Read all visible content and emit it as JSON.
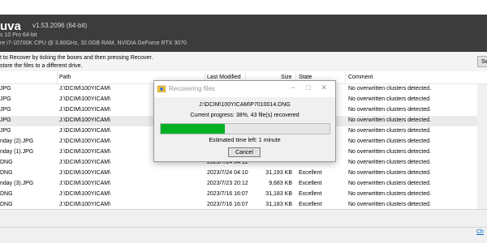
{
  "header": {
    "app_name": "uva",
    "version": "v1.53.2096 (64-bit)",
    "os": "s 10 Pro 64-bit",
    "hardware": "re i7-10700K CPU @ 3.80GHz, 32.0GB RAM, NVIDIA GeForce RTX 3070"
  },
  "instructions": {
    "line1": "t to Recover by ticking the boxes and then pressing Recover.",
    "line2": "store the files to a different drive.",
    "switch_button": "Sw"
  },
  "columns": {
    "path": "Path",
    "last_modified": "Last Modified",
    "size": "Size",
    "state": "State",
    "comment": "Comment"
  },
  "rows": [
    {
      "name": "JPG",
      "path": "J:\\DCIM\\100YICAM\\",
      "modified": "",
      "size": "",
      "state": "",
      "comment": "No overwritten clusters detected."
    },
    {
      "name": "JPG",
      "path": "J:\\DCIM\\100YICAM\\",
      "modified": "",
      "size": "",
      "state": "",
      "comment": "No overwritten clusters detected."
    },
    {
      "name": "JPG",
      "path": "J:\\DCIM\\100YICAM\\",
      "modified": "",
      "size": "",
      "state": "",
      "comment": "No overwritten clusters detected."
    },
    {
      "name": "JPG",
      "path": "J:\\DCIM\\100YICAM\\",
      "modified": "",
      "size": "",
      "state": "",
      "comment": "No overwritten clusters detected."
    },
    {
      "name": "JPG",
      "path": "J:\\DCIM\\100YICAM\\",
      "modified": "",
      "size": "",
      "state": "",
      "comment": "No overwritten clusters detected."
    },
    {
      "name": "nday (2).JPG",
      "path": "J:\\DCIM\\100YICAM\\",
      "modified": "",
      "size": "",
      "state": "",
      "comment": "No overwritten clusters detected."
    },
    {
      "name": "nday (1).JPG",
      "path": "J:\\DCIM\\100YICAM\\",
      "modified": "",
      "size": "",
      "state": "",
      "comment": "No overwritten clusters detected."
    },
    {
      "name": "DNG",
      "path": "J:\\DCIM\\100YICAM\\",
      "modified": "2023/7/24 04:11",
      "size": "",
      "state": "",
      "comment": "No overwritten clusters detected."
    },
    {
      "name": "DNG",
      "path": "J:\\DCIM\\100YICAM\\",
      "modified": "2023/7/24 04:10",
      "size": "31,193 KB",
      "state": "Excellent",
      "comment": "No overwritten clusters detected."
    },
    {
      "name": "nday (3).JPG",
      "path": "J:\\DCIM\\100YICAM\\",
      "modified": "2023/7/23 20:12",
      "size": "9,683 KB",
      "state": "Excellent",
      "comment": "No overwritten clusters detected."
    },
    {
      "name": "DNG",
      "path": "J:\\DCIM\\100YICAM\\",
      "modified": "2023/7/16 16:07",
      "size": "31,183 KB",
      "state": "Excellent",
      "comment": "No overwritten clusters detected."
    },
    {
      "name": "DNG",
      "path": "J:\\DCIM\\100YICAM\\",
      "modified": "2023/7/16 16:07",
      "size": "31,183 KB",
      "state": "Excellent",
      "comment": "No overwritten clusters detected."
    }
  ],
  "status": {
    "link": "Ch"
  },
  "dialog": {
    "title": "Recovering files",
    "file_path": "J:\\DCIM\\100YICAM\\P7010014.DNG",
    "progress_text": "Current progress: 38%, 43 file(s) recovered",
    "progress_fraction": 0.38,
    "time_left": "Estimated time left: 1 minute",
    "cancel_label": "Cancel",
    "minimize_icon": "−",
    "maximize_icon": "□",
    "close_icon": "✕",
    "progress_color": "#06b025"
  }
}
